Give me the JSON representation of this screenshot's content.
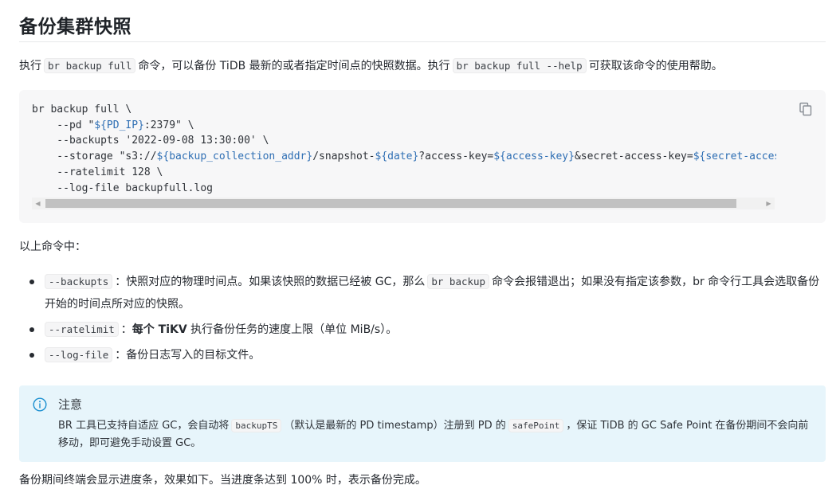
{
  "title": "备份集群快照",
  "intro": {
    "t1": "执行",
    "code1": "br backup full",
    "t2": "命令，可以备份 TiDB 最新的或者指定时间点的快照数据。执行",
    "code2": "br backup full --help",
    "t3": "可获取该命令的使用帮助。"
  },
  "codeblock": {
    "lines": [
      [
        {
          "t": "br backup full \\"
        }
      ],
      [
        {
          "t": "    --pd \""
        },
        {
          "t": "${PD_IP}",
          "v": true
        },
        {
          "t": ":2379\" \\"
        }
      ],
      [
        {
          "t": "    --backupts '2022-09-08 13:30:00' \\"
        }
      ],
      [
        {
          "t": "    --storage \"s3://"
        },
        {
          "t": "${backup_collection_addr}",
          "v": true
        },
        {
          "t": "/snapshot-"
        },
        {
          "t": "${date}",
          "v": true
        },
        {
          "t": "?access-key="
        },
        {
          "t": "${access-key}",
          "v": true
        },
        {
          "t": "&secret-access-key="
        },
        {
          "t": "${secret-access-key}",
          "v": true
        },
        {
          "t": "\" \\"
        }
      ],
      [
        {
          "t": "    --ratelimit 128 \\"
        }
      ],
      [
        {
          "t": "    --log-file backupfull.log"
        }
      ]
    ],
    "copy_icon": "copy-icon",
    "scroll_left": "◀",
    "scroll_right": "▶"
  },
  "subheading": "以上命令中：",
  "options": [
    {
      "code": "--backupts",
      "sep": "：",
      "bold": "",
      "text": "快照对应的物理时间点。如果该快照的数据已经被 GC，那么",
      "code2": "br backup",
      "text2": "命令会报错退出；如果没有指定该参数，br 命令行工具会选取备份开始的时间点所对应的快照。"
    },
    {
      "code": "--ratelimit",
      "sep": "：",
      "bold": "每个 TiKV",
      "text": "执行备份任务的速度上限（单位 MiB/s）。"
    },
    {
      "code": "--log-file",
      "sep": "：",
      "bold": "",
      "text": "备份日志写入的目标文件。"
    }
  ],
  "note": {
    "icon": "info-icon",
    "title": "注意",
    "t1": "BR 工具已支持自适应 GC，会自动将",
    "code1": "backupTS",
    "t2": "（默认是最新的 PD timestamp）注册到 PD 的",
    "code2": "safePoint",
    "t3": "，保证 TiDB 的 GC Safe Point 在备份期间不会向前移动，即可避免手动设置 GC。"
  },
  "cut_text": "备份期间终端会显示进度条，效果如下。当进度条达到 100% 时，表示备份完成。",
  "colors": {
    "accent": "#2f6fb4",
    "note_bg": "#e7f5fb",
    "note_icon": "#1a8fd0"
  }
}
